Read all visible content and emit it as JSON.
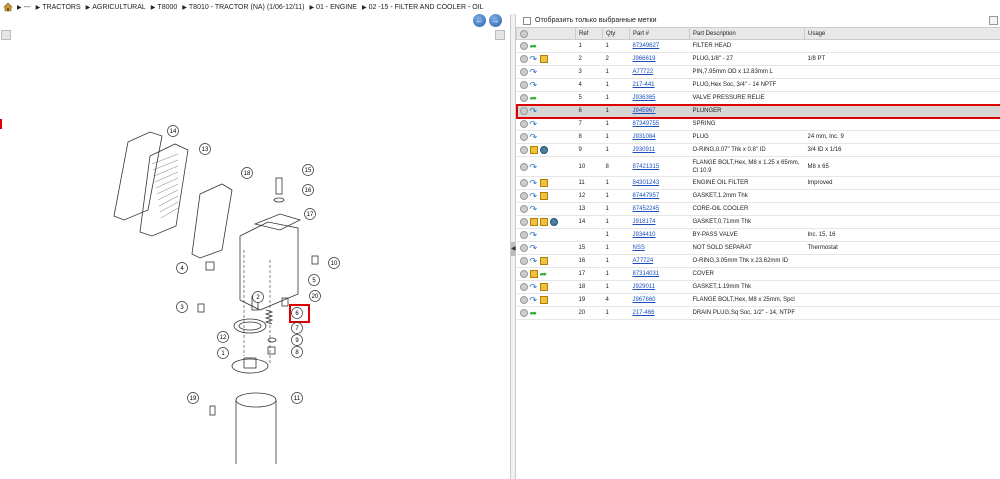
{
  "breadcrumb": {
    "items": [
      "---",
      "TRACTORS",
      "AGRICULTURAL",
      "T8000",
      "T8010 - TRACTOR (NA) (1/06-12/11)",
      "01 - ENGINE",
      "02 -15 - FILTER AND COOLER - OIL"
    ]
  },
  "filter": {
    "label": "Отобразить только выбранные метки"
  },
  "table": {
    "headers": [
      "Ref",
      "Qty",
      "Part #",
      "Part Description",
      "Usage"
    ],
    "rows": [
      {
        "ref": "1",
        "qty": "1",
        "part": "87349627",
        "desc": "FILTER HEAD",
        "usage": "",
        "icons": [
          "arrow-green"
        ]
      },
      {
        "ref": "2",
        "qty": "2",
        "part": "J966619",
        "desc": "PLUG,1/8\" - 27",
        "usage": "1/8 PT",
        "icons": [
          "arrow-blue",
          "box"
        ]
      },
      {
        "ref": "3",
        "qty": "1",
        "part": "A77722",
        "desc": "PIN,7.95mm OD x 12.83mm L",
        "usage": "",
        "icons": [
          "arrow-blue"
        ]
      },
      {
        "ref": "4",
        "qty": "1",
        "part": "217-441",
        "desc": "PLUG,Hex Soc, 3/4\" - 14 NPTF",
        "usage": "",
        "icons": [
          "arrow-blue"
        ]
      },
      {
        "ref": "5",
        "qty": "1",
        "part": "J936365",
        "desc": "VALVE PRESSURE RELIE",
        "usage": "",
        "icons": [
          "arrow-green"
        ]
      },
      {
        "ref": "6",
        "qty": "1",
        "part": "J945967",
        "desc": "PLUNGER",
        "usage": "",
        "icons": [
          "arrow-blue"
        ]
      },
      {
        "ref": "7",
        "qty": "1",
        "part": "87349755",
        "desc": "SPRING",
        "usage": "",
        "icons": [
          "arrow-blue"
        ]
      },
      {
        "ref": "8",
        "qty": "1",
        "part": "J931084",
        "desc": "PLUG",
        "usage": "24 mm, Inc. 9",
        "icons": [
          "arrow-blue"
        ]
      },
      {
        "ref": "9",
        "qty": "1",
        "part": "J930911",
        "desc": "O-RING,0.07\" Thk x 0.8\" ID",
        "usage": "3/4 ID x 1/16",
        "icons": [
          "box",
          "gear"
        ]
      },
      {
        "ref": "10",
        "qty": "8",
        "part": "87421315",
        "desc": "FLANGE BOLT,Hex, M8 x 1.25 x 65mm, Cl 10.9",
        "usage": "M8 x 65",
        "icons": [
          "arrow-blue"
        ]
      },
      {
        "ref": "11",
        "qty": "1",
        "part": "84301243",
        "desc": "ENGINE OIL FILTER",
        "usage": "Improved",
        "icons": [
          "arrow-blue",
          "box"
        ]
      },
      {
        "ref": "12",
        "qty": "1",
        "part": "87447957",
        "desc": "GASKET,1.2mm Thk",
        "usage": "",
        "icons": [
          "arrow-blue",
          "box"
        ]
      },
      {
        "ref": "13",
        "qty": "1",
        "part": "87452245",
        "desc": "CORE-OIL COOLER",
        "usage": "",
        "icons": [
          "arrow-blue"
        ]
      },
      {
        "ref": "14",
        "qty": "1",
        "part": "J918174",
        "desc": "GASKET,0.71mm Thk",
        "usage": "",
        "icons": [
          "box",
          "box",
          "gear"
        ]
      },
      {
        "ref": "",
        "qty": "1",
        "part": "J934410",
        "desc": "BY-PASS VALVE",
        "usage": "Inc. 15, 16",
        "icons": [
          "arrow-blue"
        ]
      },
      {
        "ref": "15",
        "qty": "1",
        "part": "NSS",
        "desc": "NOT SOLD SEPARAT",
        "usage": "Thermostat",
        "icons": [
          "arrow-blue"
        ]
      },
      {
        "ref": "16",
        "qty": "1",
        "part": "A77724",
        "desc": "O-RING,3.05mm Thk x 23.62mm ID",
        "usage": "",
        "icons": [
          "arrow-blue",
          "box"
        ]
      },
      {
        "ref": "17",
        "qty": "1",
        "part": "87314031",
        "desc": "COVER",
        "usage": "",
        "icons": [
          "box",
          "arrow-green"
        ]
      },
      {
        "ref": "18",
        "qty": "1",
        "part": "J929011",
        "desc": "GASKET,1.19mm Thk",
        "usage": "",
        "icons": [
          "arrow-blue",
          "box"
        ]
      },
      {
        "ref": "19",
        "qty": "4",
        "part": "J967860",
        "desc": "FLANGE BOLT,Hex, M8 x 25mm, Spcl",
        "usage": "",
        "icons": [
          "arrow-blue",
          "box"
        ]
      },
      {
        "ref": "20",
        "qty": "1",
        "part": "217-466",
        "desc": "DRAIN PLUG,Sq Soc, 1/2\" - 14, NTPF",
        "usage": "",
        "icons": [
          "arrow-green"
        ]
      }
    ],
    "selected_ref": "6"
  },
  "diagram": {
    "callouts": [
      "14",
      "13",
      "18",
      "15",
      "16",
      "17",
      "4",
      "10",
      "5",
      "20",
      "3",
      "6",
      "7",
      "12",
      "9",
      "8",
      "1",
      "19",
      "11",
      "2"
    ],
    "highlighted_callout": "6"
  },
  "colors": {
    "link": "#1a4fc0",
    "highlight": "#d00000",
    "selected_row": "#d6d6d6"
  }
}
